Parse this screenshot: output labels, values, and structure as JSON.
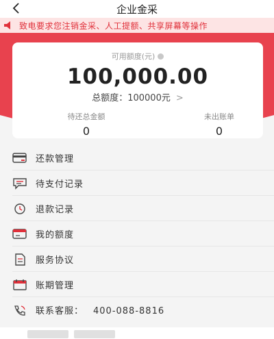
{
  "nav": {
    "title": "企业金采"
  },
  "notice": {
    "text": "致电要求您注销金采、人工提额、共享屏幕等操作"
  },
  "card": {
    "available_label": "可用额度(元)",
    "available_value": "100,000.00",
    "total_label": "总额度：100000元",
    "total_arrow": ">",
    "pending_label": "待还总金额",
    "pending_value": "0",
    "unbilled_label": "未出账单",
    "unbilled_value": "0"
  },
  "menu": [
    {
      "label": "还款管理",
      "icon": "card-icon"
    },
    {
      "label": "待支付记录",
      "icon": "chat-list-icon"
    },
    {
      "label": "退款记录",
      "icon": "refund-clock-icon"
    },
    {
      "label": "我的额度",
      "icon": "quota-card-icon"
    },
    {
      "label": "服务协议",
      "icon": "document-icon"
    },
    {
      "label": "账期管理",
      "icon": "calendar-icon"
    },
    {
      "label": "联系客服：",
      "phone": "400-088-8816",
      "icon": "phone-icon"
    }
  ],
  "colors": {
    "brand_red": "#e8424e",
    "notice_bg": "#fde4e4",
    "notice_text": "#e0303a"
  }
}
